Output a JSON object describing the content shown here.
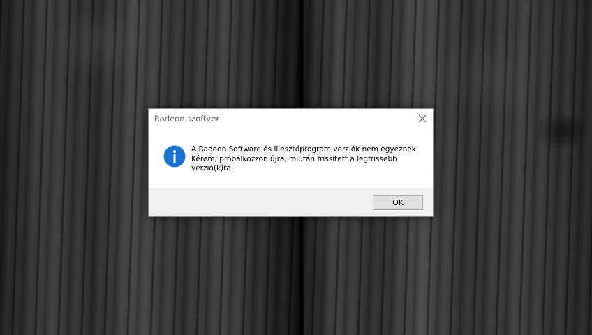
{
  "dialog": {
    "title": "Radeon szoftver",
    "message": "A Radeon Software és illesztőprogram verziók nem egyeznek. Kérem, próbálkozzon újra, miután frissített a legfrissebb verzió(k)ra.",
    "ok_label": "OK",
    "icon": "info-icon",
    "close_icon": "close-icon"
  },
  "colors": {
    "info_icon": "#1874d2",
    "button_bar": "#f0f0f0",
    "title_text": "#606060"
  }
}
